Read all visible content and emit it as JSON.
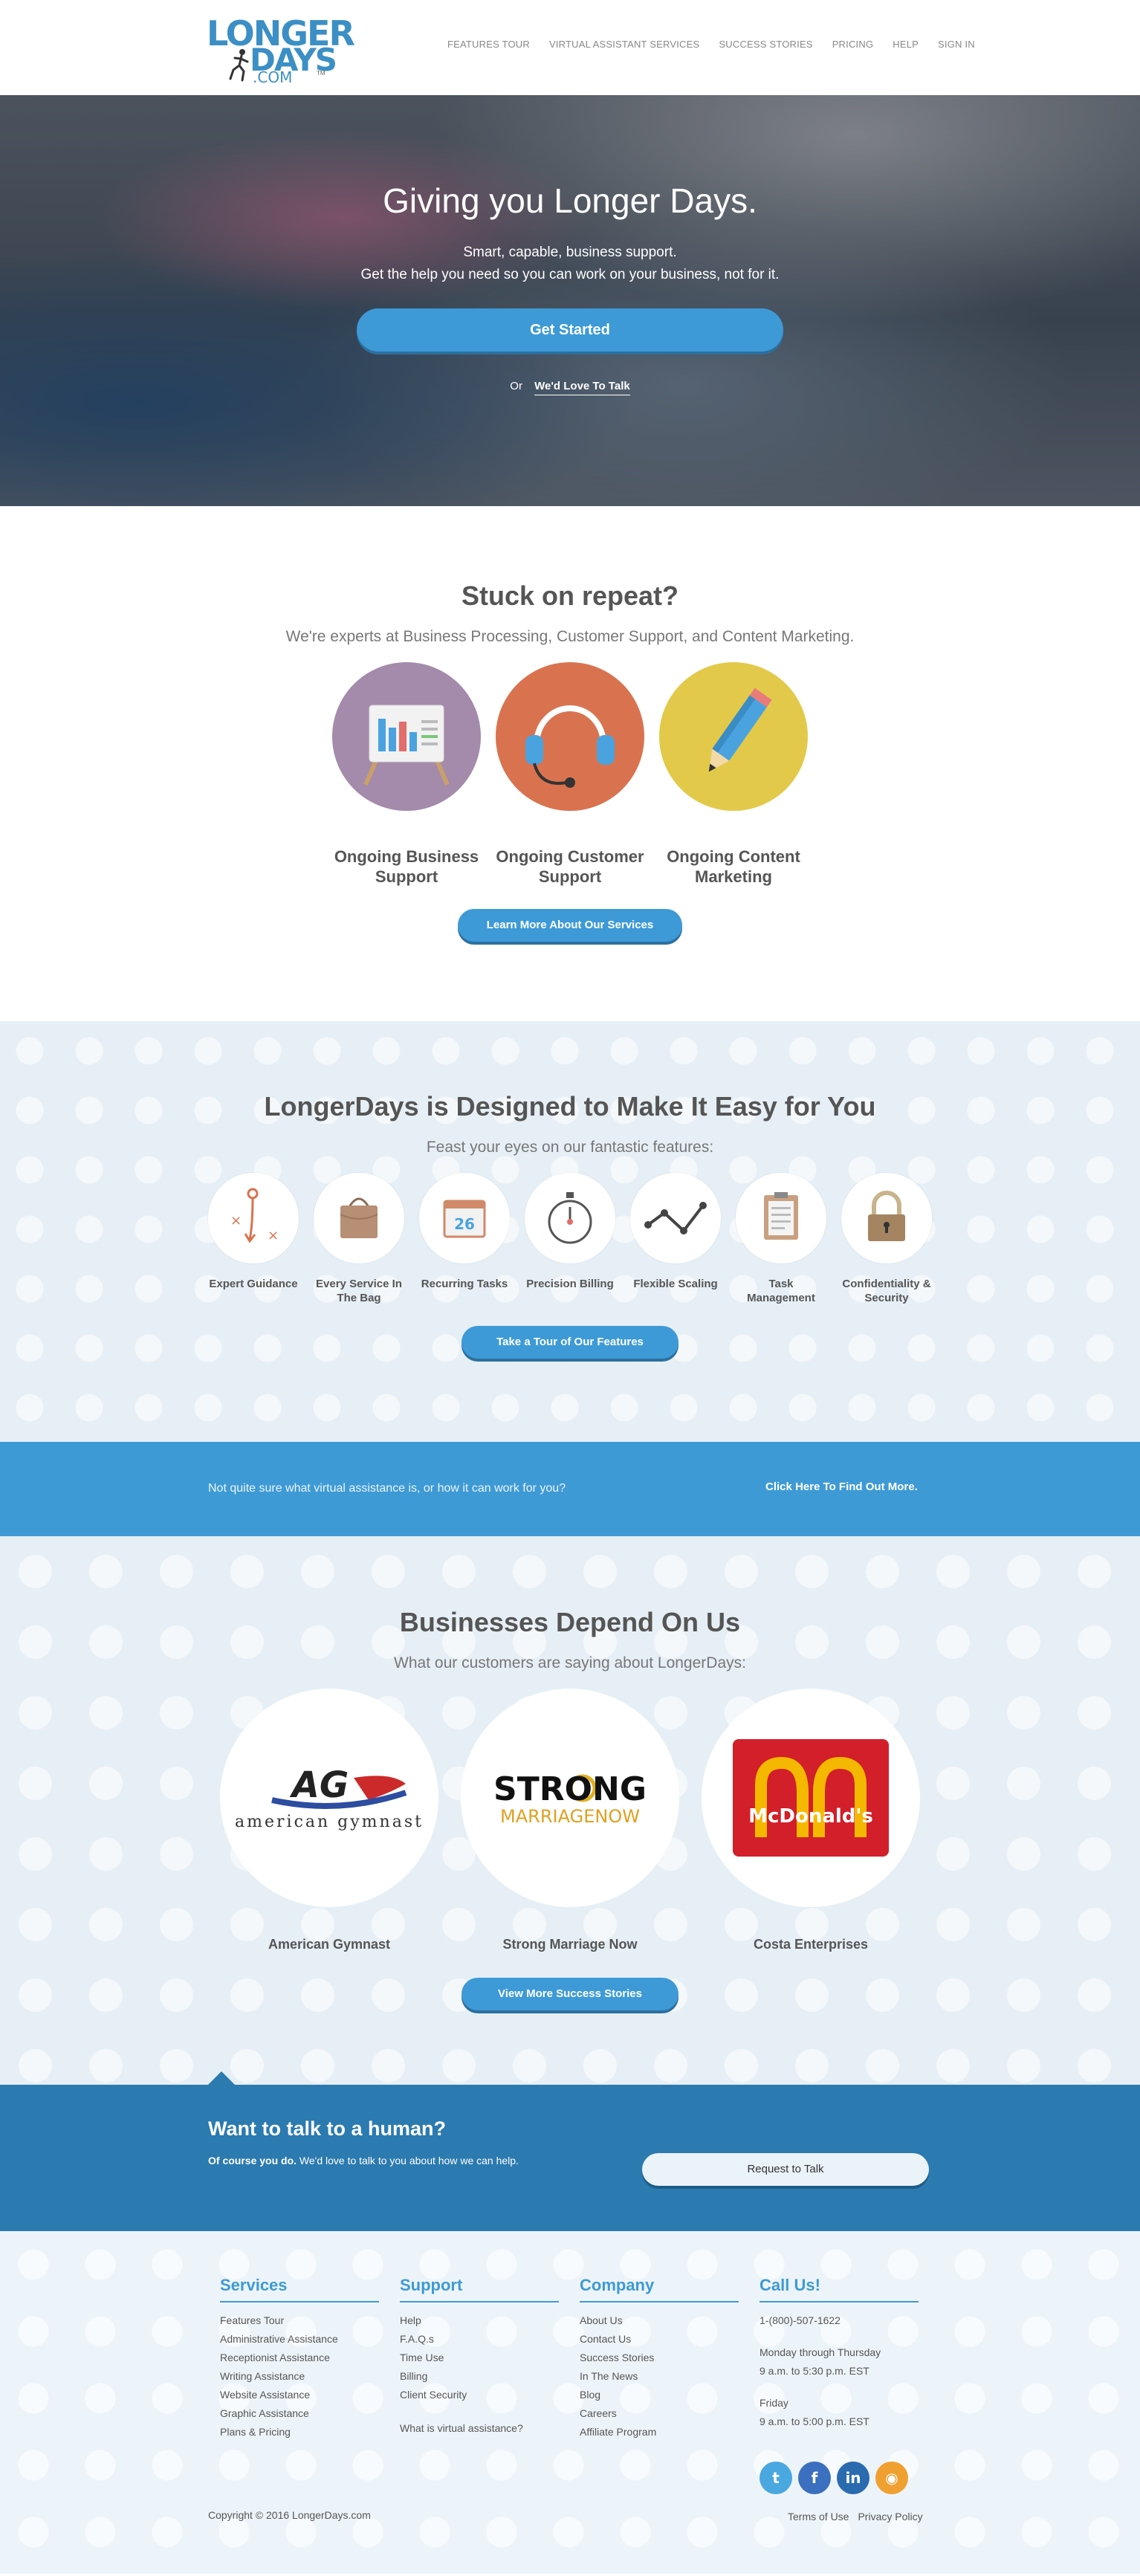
{
  "logo": {
    "line1": "LONGER",
    "line2": "DAYS",
    "line3": ".COM",
    "tm": "TM"
  },
  "nav": [
    "FEATURES TOUR",
    "VIRTUAL ASSISTANT SERVICES",
    "SUCCESS STORIES",
    "PRICING",
    "HELP",
    "SIGN IN"
  ],
  "hero": {
    "title": "Giving you Longer Days.",
    "sub1": "Smart, capable, business support.",
    "sub2": "Get the help you need so you can work on your business, not for it.",
    "cta": "Get Started",
    "or": "Or",
    "talk": "We'd Love To Talk"
  },
  "stuck": {
    "title": "Stuck on repeat?",
    "sub": "We're experts at Business Processing, Customer Support, and Content Marketing.",
    "services": [
      {
        "name": "Ongoing Business Support",
        "icon": "chart-easel-icon",
        "color": "#a48aab"
      },
      {
        "name": "Ongoing Customer Support",
        "icon": "headset-icon",
        "color": "#d9734f"
      },
      {
        "name": "Ongoing Content Marketing",
        "icon": "pencil-icon",
        "color": "#e3c94a"
      }
    ],
    "button": "Learn More About Our Services"
  },
  "features": {
    "title": "LongerDays is Designed to Make It Easy for You",
    "sub": "Feast your eyes on our fantastic features:",
    "items": [
      {
        "name": "Expert Guidance",
        "icon": "strategy-icon"
      },
      {
        "name": "Every Service In The Bag",
        "icon": "bag-icon"
      },
      {
        "name": "Recurring Tasks",
        "icon": "calendar-icon",
        "day": "26"
      },
      {
        "name": "Precision Billing",
        "icon": "stopwatch-icon"
      },
      {
        "name": "Flexible Scaling",
        "icon": "graph-icon"
      },
      {
        "name": "Task Management",
        "icon": "clipboard-icon"
      },
      {
        "name": "Confidentiality & Security",
        "icon": "padlock-icon"
      }
    ],
    "button": "Take a Tour of Our Features"
  },
  "band": {
    "question": "Not quite sure what virtual assistance is, or how it can work for you?",
    "link": "Click Here To Find Out More."
  },
  "businesses": {
    "title": "Businesses Depend On Us",
    "sub": "What our customers are saying about LongerDays:",
    "items": [
      {
        "name": "American Gymnast",
        "logo_text": "AG",
        "logo_sub": "american gymnast"
      },
      {
        "name": "Strong Marriage Now",
        "logo_text": "STRONG",
        "logo_sub": "MARRIAGENOW"
      },
      {
        "name": "Costa Enterprises",
        "logo_text": "McDonald's"
      }
    ],
    "button": "View More Success Stories"
  },
  "talk": {
    "title": "Want to talk to a human?",
    "sub_bold": "Of course you do.",
    "sub": " We'd love to talk to you about how we can help.",
    "button": "Request to Talk"
  },
  "footer": {
    "services": {
      "title": "Services",
      "items": [
        "Features Tour",
        "Administrative Assistance",
        "Receptionist Assistance",
        "Writing Assistance",
        "Website Assistance",
        "Graphic Assistance",
        "Plans & Pricing"
      ]
    },
    "support": {
      "title": "Support",
      "items": [
        "Help",
        "F.A.Q.s",
        "Time Use",
        "Billing",
        "Client Security"
      ],
      "extra": "What is virtual assistance?"
    },
    "company": {
      "title": "Company",
      "items": [
        "About Us",
        "Contact Us",
        "Success Stories",
        "In The News",
        "Blog",
        "Careers",
        "Affiliate Program"
      ]
    },
    "call": {
      "title": "Call Us!",
      "phone": "1-(800)-507-1622",
      "days1": "Monday through Thursday",
      "hours1": "9 a.m. to 5:30 p.m. EST",
      "days2": "Friday",
      "hours2": "9 a.m. to 5:00 p.m. EST"
    },
    "social": [
      {
        "name": "twitter-icon",
        "glyph": "t",
        "color": "#4aa8e0"
      },
      {
        "name": "facebook-icon",
        "glyph": "f",
        "color": "#3b6fbf"
      },
      {
        "name": "linkedin-icon",
        "glyph": "in",
        "color": "#2a6bb0"
      },
      {
        "name": "rss-icon",
        "glyph": "◉",
        "color": "#f0a030"
      }
    ],
    "copyright": "Copyright © 2016 LongerDays.com",
    "terms": "Terms of Use",
    "privacy": "Privacy Policy"
  }
}
